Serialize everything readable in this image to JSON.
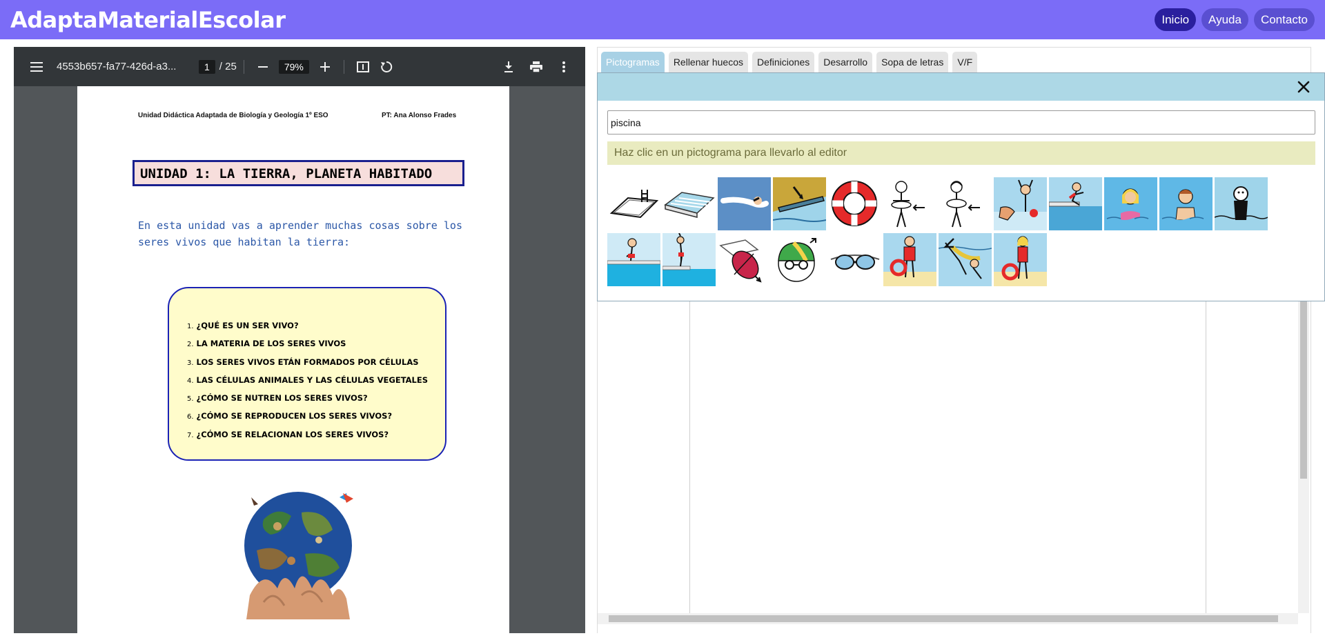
{
  "app": {
    "brand": "AdaptaMaterialEscolar",
    "nav": [
      {
        "label": "Inicio"
      },
      {
        "label": "Ayuda"
      },
      {
        "label": "Contacto"
      }
    ]
  },
  "pdf_viewer": {
    "file_name": "4553b657-fa77-426d-a3...",
    "current_page": "1",
    "total_pages": "/ 25",
    "zoom": "79%",
    "icons": [
      "menu-icon",
      "zoom-out-icon",
      "zoom-in-icon",
      "fit-page-icon",
      "rotate-icon",
      "download-icon",
      "print-icon",
      "more-icon"
    ],
    "page": {
      "header_left": "Unidad Didáctica Adaptada de Biología y Geología 1º ESO",
      "header_right": "PT: Ana Alonso Frades",
      "title": "UNIDAD 1: LA TIERRA, PLANETA HABITADO",
      "intro": "En esta unidad vas a aprender muchas cosas sobre los seres vivos que habitan la tierra:",
      "index": [
        {
          "n": "1.",
          "text": "¿QUÉ ES UN SER VIVO?"
        },
        {
          "n": "2.",
          "text": "LA MATERIA DE LOS SERES VIVOS"
        },
        {
          "n": "3.",
          "text": "LOS SERES VIVOS ETÁN FORMADOS POR CÉLULAS"
        },
        {
          "n": "4.",
          "text": "LAS CÉLULAS ANIMALES Y LAS CÉLULAS VEGETALES"
        },
        {
          "n": "5.",
          "text": "¿CÓMO SE NUTREN LOS SERES VIVOS?"
        },
        {
          "n": "6.",
          "text": "¿CÓMO SE REPRODUCEN LOS SERES VIVOS?"
        },
        {
          "n": "7.",
          "text": "¿CÓMO SE RELACIONAN LOS SERES VIVOS?"
        }
      ]
    }
  },
  "tabs": [
    {
      "label": "Pictogramas",
      "active": true
    },
    {
      "label": "Rellenar huecos",
      "active": false
    },
    {
      "label": "Definiciones",
      "active": false
    },
    {
      "label": "Desarrollo",
      "active": false
    },
    {
      "label": "Sopa de letras",
      "active": false
    },
    {
      "label": "V/F",
      "active": false
    }
  ],
  "pictogram_popup": {
    "search_value": "piscina",
    "hint": "Haz clic en un pictograma para llevarlo al editor",
    "pictograms": [
      "pool-icon",
      "pool-lanes-icon",
      "swimmer-icon",
      "diving-board-icon",
      "lifebuoy-icon",
      "child-with-float-icon",
      "girl-with-float-icon",
      "lifeguard-rescue-icon",
      "jumping-into-pool-icon",
      "girl-in-water-icon",
      "boy-in-water-icon",
      "person-in-water-icon",
      "boy-at-pool-edge-icon",
      "diving-boy-icon",
      "kickboard-icon",
      "swim-cap-icon",
      "swim-goggles-icon",
      "lifeguard-boy-icon",
      "underwater-rescue-icon",
      "lifeguard-girl-icon"
    ]
  },
  "colors": {
    "topbar": "#7b6cf7",
    "nav_active": "#2a1f9e",
    "nav_button": "#5a4fd1",
    "tab_active": "#a8d1e5",
    "popup_header": "#add8e6",
    "hint_bg": "#e9ebc0"
  }
}
